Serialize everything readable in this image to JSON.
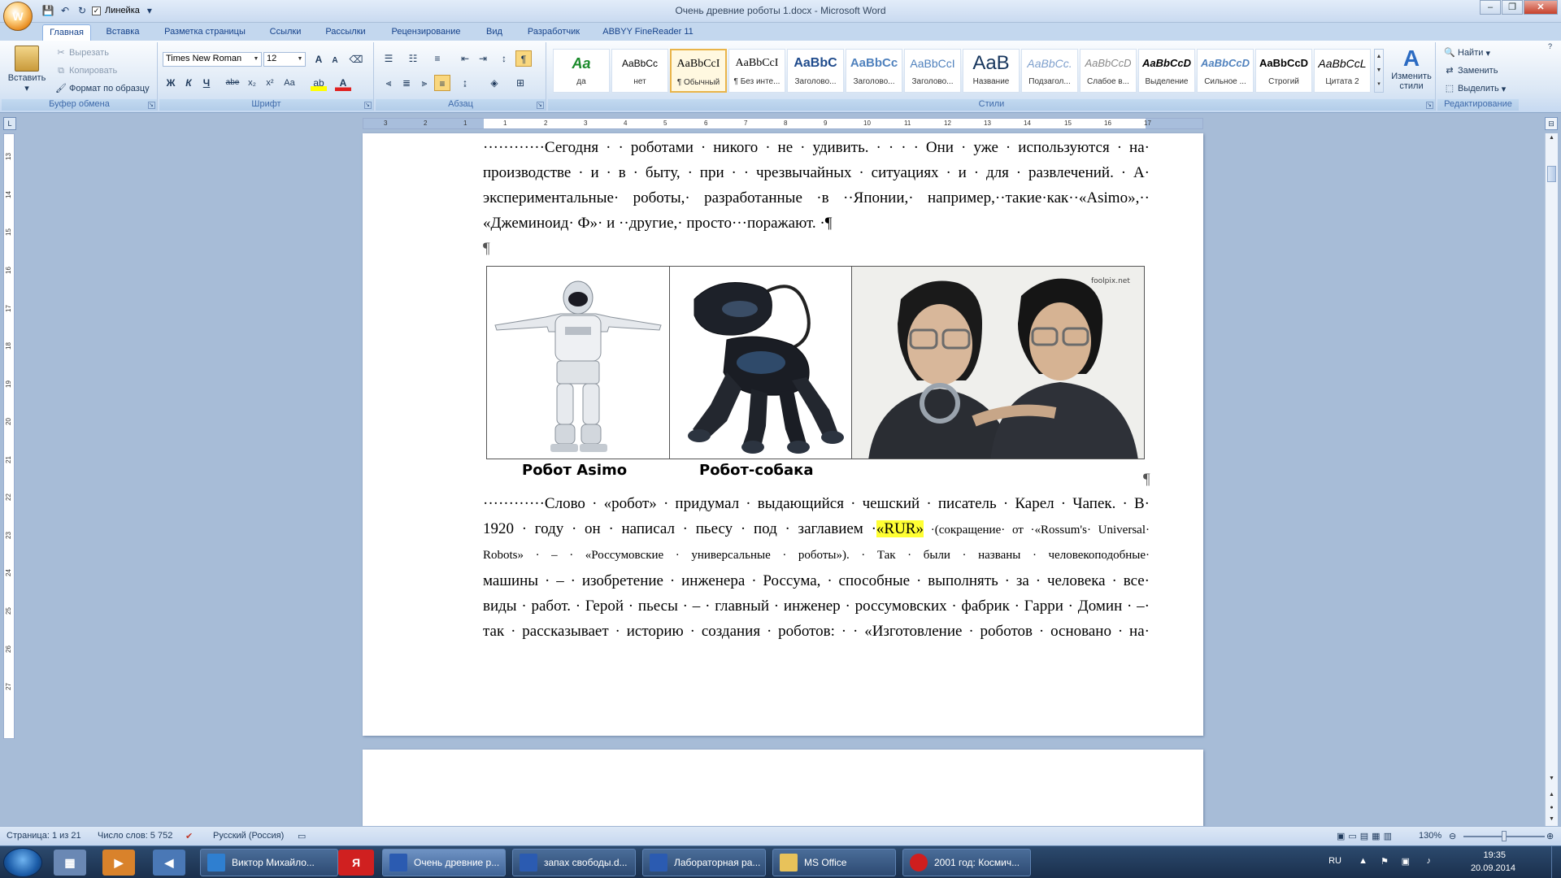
{
  "window": {
    "title": "Очень древние роботы 1.docx - Microsoft Word",
    "qat_label": "Линейка"
  },
  "tabs": [
    "Главная",
    "Вставка",
    "Разметка страницы",
    "Ссылки",
    "Рассылки",
    "Рецензирование",
    "Вид",
    "Разработчик",
    "ABBYY FineReader 11"
  ],
  "ribbon": {
    "clipboard": {
      "paste": "Вставить",
      "cut": "Вырезать",
      "copy": "Копировать",
      "format_painter": "Формат по образцу",
      "label": "Буфер обмена"
    },
    "font": {
      "name": "Times New Roman",
      "size": "12",
      "label": "Шрифт",
      "bold": "Ж",
      "italic": "К",
      "underline": "Ч",
      "strike": "abe",
      "sub": "x₂",
      "sup": "x²",
      "case": "Aa",
      "grow": "A",
      "shrink": "A",
      "font_color": "A"
    },
    "paragraph": {
      "label": "Абзац",
      "pilcrow": "¶"
    },
    "styles": {
      "label": "Стили",
      "items": [
        {
          "sample": "Aa",
          "name": "да"
        },
        {
          "sample": "AaBbCc",
          "name": "нет"
        },
        {
          "sample": "AaBbCcI",
          "name": "¶ Обычный"
        },
        {
          "sample": "AaBbCcI",
          "name": "¶ Без инте..."
        },
        {
          "sample": "AaBbC",
          "name": "Заголово..."
        },
        {
          "sample": "AaBbCc",
          "name": "Заголово..."
        },
        {
          "sample": "AaBbCcI",
          "name": "Заголово..."
        },
        {
          "sample": "AaB",
          "name": "Название"
        },
        {
          "sample": "AaBbCc.",
          "name": "Подзагол..."
        },
        {
          "sample": "AaBbCcD",
          "name": "Слабое в..."
        },
        {
          "sample": "AaBbCcD",
          "name": "Выделение"
        },
        {
          "sample": "AaBbCcD",
          "name": "Сильное ..."
        },
        {
          "sample": "AaBbCcD",
          "name": "Строгий"
        },
        {
          "sample": "AaBbCcL",
          "name": "Цитата 2"
        }
      ],
      "change": "Изменить стили"
    },
    "editing": {
      "label": "Редактирование",
      "find": "Найти",
      "replace": "Заменить",
      "select": "Выделить"
    }
  },
  "ruler": {
    "ticks": [
      "3",
      "2",
      "1",
      "1",
      "2",
      "3",
      "4",
      "5",
      "6",
      "7",
      "8",
      "9",
      "10",
      "11",
      "12",
      "13",
      "14",
      "15",
      "16",
      "17"
    ]
  },
  "vruler": {
    "ticks": [
      "13",
      "14",
      "15",
      "16",
      "17",
      "18",
      "19",
      "20",
      "21",
      "22",
      "23",
      "24",
      "25",
      "26",
      "27"
    ]
  },
  "document": {
    "para1": [
      "············Сегодня · · роботами · никого · не · удивить. · · · · Они · уже · используются · на·",
      "производстве · и · в · быту, · при · · чрезвычайных · ситуациях · и · для · развлечений. · А·",
      "экспериментальные· роботы,· разработанные ·в ··Японии,· например,··такие·как··«Asimo»,··",
      "«Джеминоид· Ф»· и ··другие,· просто···поражают. ·¶"
    ],
    "empty_para": "¶",
    "captions": [
      "Робот Asimo",
      "Робот-собака"
    ],
    "watermark": "foolpix.net",
    "pilcrow_right": "¶",
    "para2": {
      "l1": "············Слово · «робот» · придумал · выдающийся · чешский · писатель · Карел · Чапек. · В·",
      "l2_pre": "1920 · году · он · написал · пьесу · под · заглавием ·",
      "l2_hl": "«RUR»",
      "l2_post": " ·(сокращение· от ·«Rossum's· Universal·",
      "l3": "Robots» · – · «Россумовские · универсальные · роботы»). · Так · были · названы · человекоподобные·",
      "l4": "машины · – · изобретение · инженера · Россума, · способные · выполнять · за · человека · все·",
      "l5": "виды · работ. · Герой · пьесы · – · главный · инженер · россумовских · фабрик · Гарри · Домин · –·",
      "l6": "так · рассказывает · историю · создания · роботов: · · «Изготовление · роботов · основано · на·"
    }
  },
  "status": {
    "page": "Страница: 1 из 21",
    "words": "Число слов: 5 752",
    "lang": "Русский (Россия)",
    "zoom": "130%"
  },
  "taskbar": {
    "tasks": [
      "Виктор Михайло...",
      "Очень древние р...",
      "запах свободы.d...",
      "Лабораторная ра...",
      "MS Office",
      "2001 год: Космич..."
    ],
    "lang": "RU",
    "time": "19:35",
    "date": "20.09.2014"
  }
}
